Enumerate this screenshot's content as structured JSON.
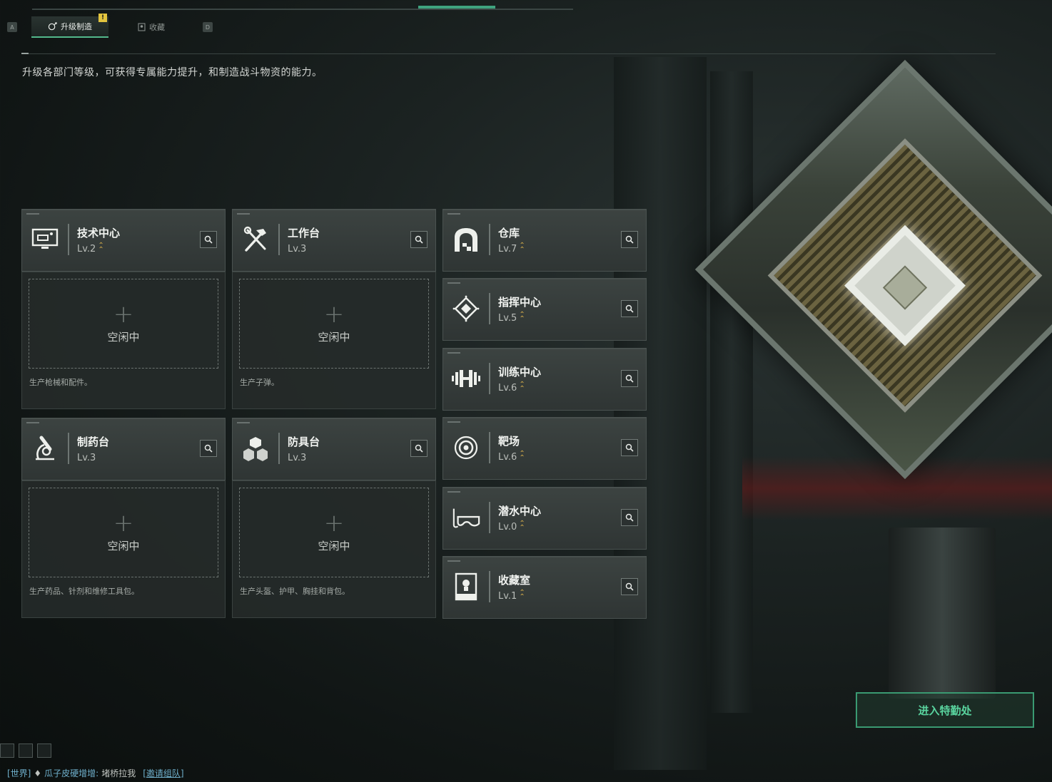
{
  "colors": {
    "accent": "#53b98c",
    "gold": "#d7ae4b",
    "enter_border": "#3a9a72"
  },
  "tabs": [
    {
      "key": "A",
      "label": "升级制造",
      "icon": "upgrade-icon",
      "badge": "!",
      "active": true
    },
    {
      "label": "收藏",
      "icon": "collection-icon",
      "active": false
    },
    {
      "key": "D"
    }
  ],
  "description": "升级各部门等级，可获得专属能力提升，和制造战斗物资的能力。",
  "stations": [
    {
      "name": "技术中心",
      "level": "Lv.2",
      "icon": "monitor-icon"
    },
    {
      "name": "工作台",
      "level": "Lv.3",
      "icon": "tools-icon"
    },
    {
      "name": "制药台",
      "level": "Lv.3",
      "icon": "microscope-icon"
    },
    {
      "name": "防具台",
      "level": "Lv.3",
      "icon": "armor-blocks-icon"
    }
  ],
  "production_slots": [
    {
      "status": "空闲中",
      "desc": "生产枪械和配件。"
    },
    {
      "status": "空闲中",
      "desc": "生产子弹。"
    },
    {
      "status": "空闲中",
      "desc": "生产药品、针剂和维修工具包。"
    },
    {
      "status": "空闲中",
      "desc": "生产头盔、护甲、胸挂和背包。"
    }
  ],
  "facilities": [
    {
      "name": "仓库",
      "level": "Lv.7",
      "icon": "warehouse-icon"
    },
    {
      "name": "指挥中心",
      "level": "Lv.5",
      "icon": "command-icon"
    },
    {
      "name": "训练中心",
      "level": "Lv.6",
      "icon": "dumbbell-icon"
    },
    {
      "name": "靶场",
      "level": "Lv.6",
      "icon": "target-icon"
    },
    {
      "name": "潜水中心",
      "level": "Lv.0",
      "icon": "diving-mask-icon"
    },
    {
      "name": "收藏室",
      "level": "Lv.1",
      "icon": "display-case-icon"
    }
  ],
  "enter_button": "进入特勤处",
  "chat": {
    "channel": "[世界]",
    "nick": "瓜子皮硬增增:",
    "message": "堵桥拉我",
    "invite": "[邀请组队]"
  }
}
